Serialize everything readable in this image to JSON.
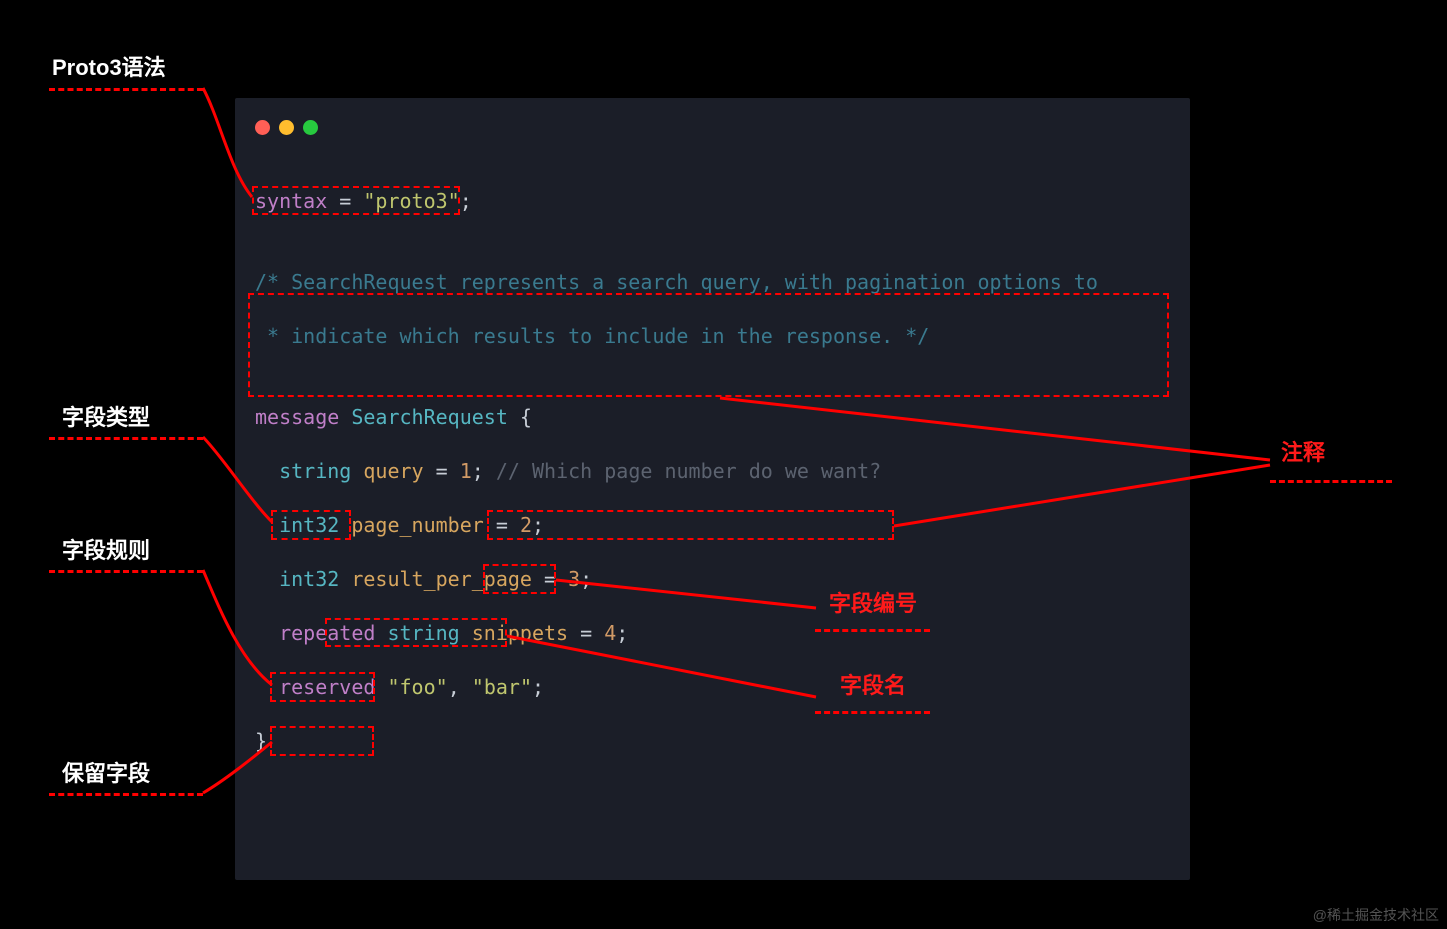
{
  "labels": {
    "proto3_syntax": "Proto3语法",
    "field_type": "字段类型",
    "field_rule": "字段规则",
    "reserved_field": "保留字段",
    "comment": "注释",
    "field_number": "字段编号",
    "field_name": "字段名"
  },
  "code": {
    "syntax_kw": "syntax",
    "syntax_eq": " = ",
    "syntax_val": "\"proto3\"",
    "syntax_semi": ";",
    "block_comment_l1": "/* SearchRequest represents a search query, with pagination options to",
    "block_comment_l2": " * indicate which results to include in the response. */",
    "msg_kw": "message",
    "msg_name": " SearchRequest ",
    "brace_open": "{",
    "f1_indent": "  ",
    "f1_type": "string",
    "f1_name": " query ",
    "f1_eq": "= ",
    "f1_num": "1",
    "f1_semi": "; ",
    "f1_cmt": "// Which page number do we want?",
    "f2_indent": "  ",
    "f2_type": "int32",
    "f2_name": " page_number ",
    "f2_eq": "= ",
    "f2_num": "2",
    "f2_semi": ";",
    "f3_indent": "  ",
    "f3_type": "int32",
    "f3_name": " result_per_page ",
    "f3_eq": "= ",
    "f3_num": "3",
    "f3_semi": ";",
    "f4_indent": "  ",
    "f4_rule": "repeated",
    "f4_type": " string",
    "f4_name": " snippets ",
    "f4_eq": "= ",
    "f4_num": "4",
    "f4_semi": ";",
    "r_indent": "  ",
    "r_kw": "reserved",
    "r_sp": " ",
    "r_v1": "\"foo\"",
    "r_comma": ", ",
    "r_v2": "\"bar\"",
    "r_semi": ";",
    "brace_close": "}"
  },
  "watermark": "@稀土掘金技术社区"
}
